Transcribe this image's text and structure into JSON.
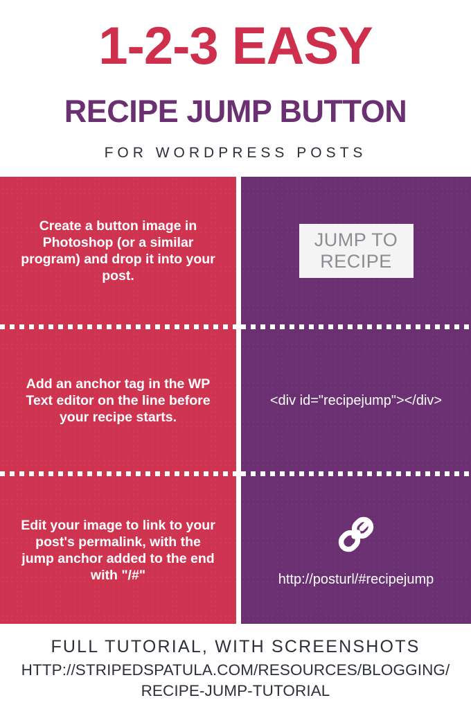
{
  "header": {
    "title_main": "1-2-3 EASY",
    "title_sub": "RECIPE JUMP BUTTON",
    "tagline": "FOR WORDPRESS POSTS",
    "color_red": "#ce2f4c",
    "color_purple": "#6b3071",
    "color_ink": "#2c3038"
  },
  "steps": [
    {
      "instruction": "Create a button image in Photoshop (or a similar program) and drop it into your post.",
      "example_type": "button-image",
      "button_line1": "JUMP TO",
      "button_line2": "RECIPE"
    },
    {
      "instruction": "Add an anchor tag in the WP Text editor on the line before your recipe starts.",
      "example_type": "code",
      "code": "<div id=\"recipejump\"></div>"
    },
    {
      "instruction": "Edit your image to link to your post's permalink, with the jump anchor added to the end with \"/#\"",
      "example_type": "link",
      "icon": "chain-link-icon",
      "url": "http://posturl/#recipejump"
    }
  ],
  "panels": {
    "left_bg": "#ce3450",
    "right_bg": "#6b3071",
    "button_bg": "#f4f4f5",
    "button_text_color": "#8c8c91"
  },
  "footer": {
    "line1": "FULL TUTORIAL, WITH SCREENSHOTS",
    "line2": "HTTP://STRIPEDSPATULA.COM/RESOURCES/BLOGGING/",
    "line3": "RECIPE-JUMP-TUTORIAL"
  }
}
